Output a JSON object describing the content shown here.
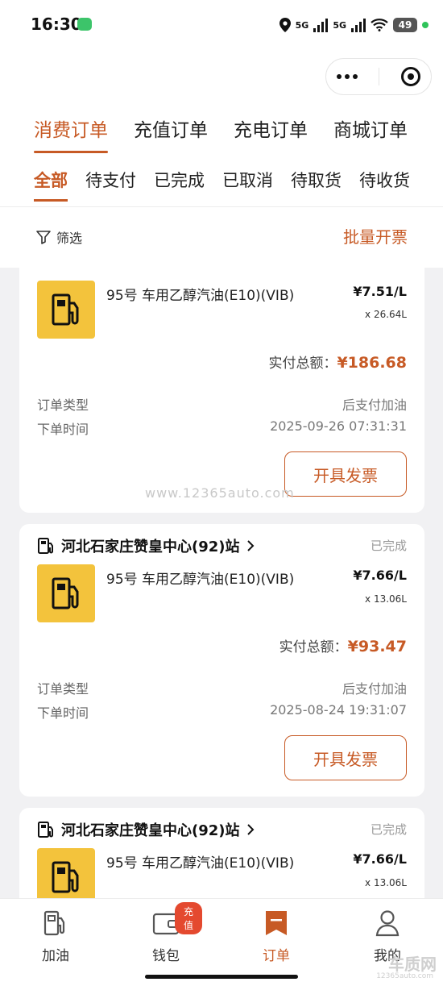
{
  "status_bar": {
    "time": "16:30",
    "net1": "5G",
    "net2": "5G",
    "battery": "49"
  },
  "main_tabs": [
    {
      "label": "消费订单"
    },
    {
      "label": "充值订单"
    },
    {
      "label": "充电订单"
    },
    {
      "label": "商城订单"
    }
  ],
  "sub_tabs": [
    {
      "label": "全部"
    },
    {
      "label": "待支付"
    },
    {
      "label": "已完成"
    },
    {
      "label": "已取消"
    },
    {
      "label": "待取货"
    },
    {
      "label": "待收货"
    }
  ],
  "toolbar": {
    "filter_label": "筛选",
    "batch_label": "批量开票"
  },
  "orders": [
    {
      "station": "",
      "status": "",
      "product": "95号 车用乙醇汽油(E10)(VIB)",
      "unit_price": "¥7.51/L",
      "quantity": "x 26.64L",
      "total_label": "实付总额：",
      "total_value": "¥186.68",
      "type_label": "订单类型",
      "type_value": "后支付加油",
      "time_label": "下单时间",
      "time_value": "2025-09-26 07:31:31",
      "button": "开具发票"
    },
    {
      "station": "河北石家庄赞皇中心(92)站",
      "status": "已完成",
      "product": "95号 车用乙醇汽油(E10)(VIB)",
      "unit_price": "¥7.66/L",
      "quantity": "x 13.06L",
      "total_label": "实付总额：",
      "total_value": "¥93.47",
      "type_label": "订单类型",
      "type_value": "后支付加油",
      "time_label": "下单时间",
      "time_value": "2025-08-24 19:31:07",
      "button": "开具发票"
    },
    {
      "station": "河北石家庄赞皇中心(92)站",
      "status": "已完成",
      "product": "95号 车用乙醇汽油(E10)(VIB)",
      "unit_price": "¥7.66/L",
      "quantity": "x 13.06L"
    }
  ],
  "watermark": "www.12365auto.com",
  "tabbar": [
    {
      "label": "加油"
    },
    {
      "label": "钱包",
      "badge": "充值"
    },
    {
      "label": "订单"
    },
    {
      "label": "我的"
    }
  ],
  "corner_mark": "车质网",
  "corner_sub": "12365auto.com",
  "colors": {
    "accent": "#c75a25",
    "thumb": "#f3c33c",
    "badge": "#e4492f"
  }
}
